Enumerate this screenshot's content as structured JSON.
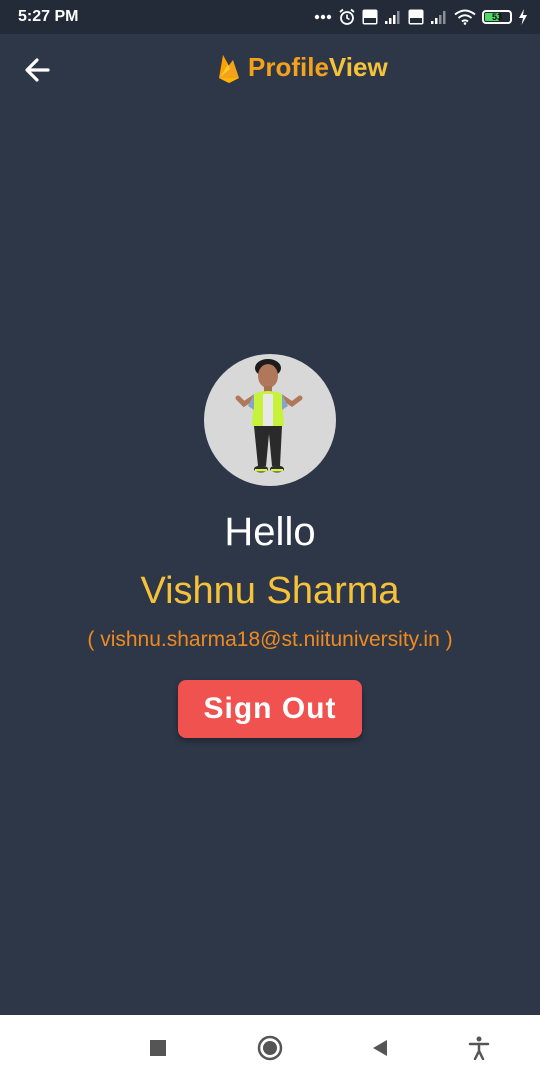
{
  "status_bar": {
    "time": "5:27 PM",
    "battery_level": "53",
    "icons": [
      "more-dots-icon",
      "alarm-icon",
      "volte-icon",
      "signal-icon",
      "volte-icon",
      "signal-icon",
      "wifi-icon",
      "battery-icon",
      "charging-bolt-icon"
    ]
  },
  "app_bar": {
    "title_part1": "Profile",
    "title_part2": "View",
    "logo_icon": "firebase-flame-icon",
    "back_icon": "arrow-left-icon"
  },
  "profile": {
    "greeting": "Hello",
    "name": "Vishnu Sharma",
    "email": "( vishnu.sharma18@st.niituniversity.in )",
    "avatar_icon": "avatar-cartoon-icon"
  },
  "actions": {
    "sign_out_label": "Sign Out"
  },
  "nav_bar": {
    "icons": [
      "recents-square-icon",
      "home-circle-icon",
      "back-triangle-icon",
      "accessibility-icon"
    ]
  },
  "colors": {
    "background": "#2e3748",
    "status_bar": "#232b39",
    "accent_orange": "#f4a11b",
    "accent_yellow": "#f6c23a",
    "email_orange": "#ef8a1f",
    "sign_out_red": "#f0534f",
    "avatar_bg": "#d8d8d8"
  }
}
